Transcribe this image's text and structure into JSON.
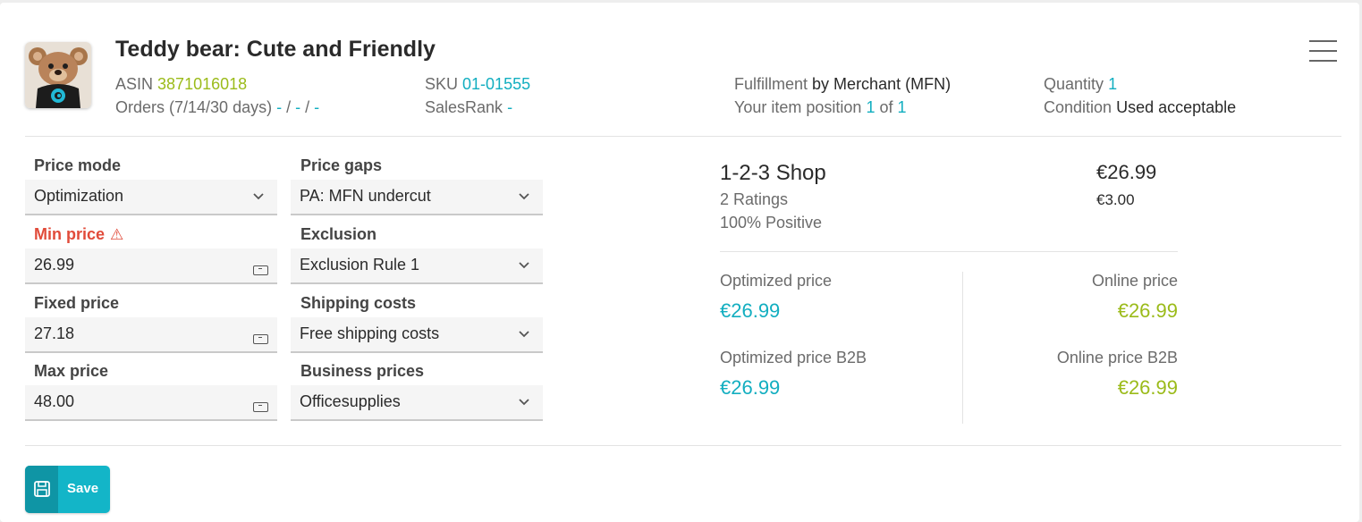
{
  "product": {
    "title": "Teddy bear: Cute and Friendly",
    "thumbnail_alt": "teddy-bear-image"
  },
  "meta": {
    "asin_label": "ASIN",
    "asin": "3871016018",
    "orders_label": "Orders (7/14/30 days)",
    "orders_7": "-",
    "orders_14": "-",
    "orders_30": "-",
    "sku_label": "SKU",
    "sku": "01-01555",
    "salesrank_label": "SalesRank",
    "salesrank": "-",
    "fulfillment_label": "Fulfillment",
    "fulfillment": "by Merchant (MFN)",
    "position_label": "Your item position",
    "position": "1",
    "position_of": "of",
    "position_total": "1",
    "quantity_label": "Quantity",
    "quantity": "1",
    "condition_label": "Condition",
    "condition": "Used acceptable"
  },
  "form": {
    "price_mode_label": "Price mode",
    "price_mode": "Optimization",
    "min_price_label": "Min price",
    "min_price": "26.99",
    "fixed_price_label": "Fixed price",
    "fixed_price": "27.18",
    "max_price_label": "Max price",
    "max_price": "48.00",
    "price_gaps_label": "Price gaps",
    "price_gaps": "PA: MFN undercut",
    "exclusion_label": "Exclusion",
    "exclusion": "Exclusion Rule 1",
    "shipping_label": "Shipping costs",
    "shipping": "Free shipping costs",
    "business_label": "Business prices",
    "business": "Officesupplies"
  },
  "offer": {
    "shop": "1-2-3 Shop",
    "ratings": "2 Ratings",
    "positive": "100% Positive",
    "price": "€26.99",
    "shipping": "€3.00"
  },
  "summary": {
    "optimized_label": "Optimized price",
    "optimized": "€26.99",
    "online_label": "Online price",
    "online": "€26.99",
    "optimized_b2b_label": "Optimized price B2B",
    "optimized_b2b": "€26.99",
    "online_b2b_label": "Online price B2B",
    "online_b2b": "€26.99"
  },
  "actions": {
    "save_label": "Save"
  },
  "colors": {
    "accent_teal": "#12aec0",
    "accent_lime": "#9bbb1a",
    "error_red": "#e14b3a"
  }
}
